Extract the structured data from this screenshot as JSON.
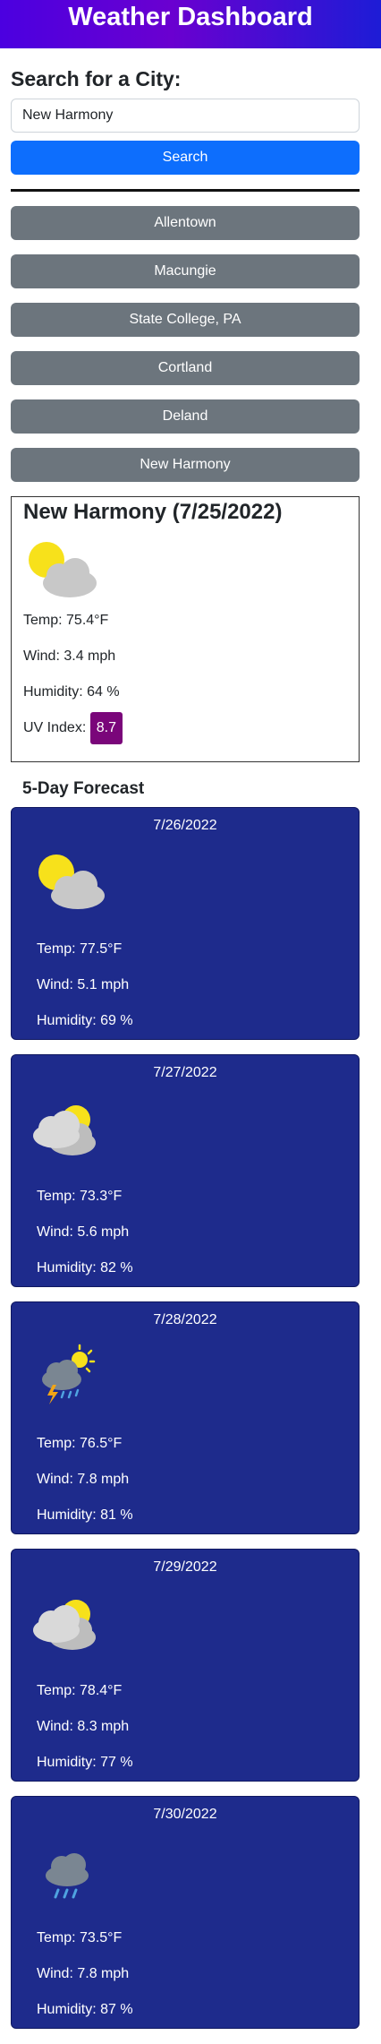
{
  "header": {
    "title": "Weather Dashboard"
  },
  "search": {
    "heading": "Search for a City:",
    "value": "New Harmony",
    "button_label": "Search"
  },
  "history": [
    {
      "label": "Allentown"
    },
    {
      "label": "Macungie"
    },
    {
      "label": "State College, PA"
    },
    {
      "label": "Cortland"
    },
    {
      "label": "Deland"
    },
    {
      "label": "New Harmony"
    }
  ],
  "current": {
    "title": "New Harmony (7/25/2022)",
    "icon": "partly-cloudy-icon",
    "temp": "Temp: 75.4°F",
    "wind": "Wind: 3.4 mph",
    "humidity": "Humidity: 64 %",
    "uv_label": "UV Index:",
    "uv_value": "8.7",
    "uv_color": "#7a067a"
  },
  "forecast": {
    "heading": "5-Day Forecast",
    "days": [
      {
        "date": "7/26/2022",
        "icon": "partly-cloudy-icon",
        "temp": "Temp: 77.5°F",
        "wind": "Wind: 5.1 mph",
        "humidity": "Humidity: 69 %"
      },
      {
        "date": "7/27/2022",
        "icon": "mostly-cloudy-icon",
        "temp": "Temp: 73.3°F",
        "wind": "Wind: 5.6 mph",
        "humidity": "Humidity: 82 %"
      },
      {
        "date": "7/28/2022",
        "icon": "thunderstorm-icon",
        "temp": "Temp: 76.5°F",
        "wind": "Wind: 7.8 mph",
        "humidity": "Humidity: 81 %"
      },
      {
        "date": "7/29/2022",
        "icon": "mostly-cloudy-icon",
        "temp": "Temp: 78.4°F",
        "wind": "Wind: 8.3 mph",
        "humidity": "Humidity: 77 %"
      },
      {
        "date": "7/30/2022",
        "icon": "rain-icon",
        "temp": "Temp: 73.5°F",
        "wind": "Wind: 7.8 mph",
        "humidity": "Humidity: 87 %"
      }
    ]
  },
  "colors": {
    "header_gradient_start": "#4b00e0",
    "header_gradient_end": "#1d1cd6",
    "search_button": "#0d6efd",
    "history_button": "#6c757d",
    "forecast_card": "#1e2b8c"
  }
}
